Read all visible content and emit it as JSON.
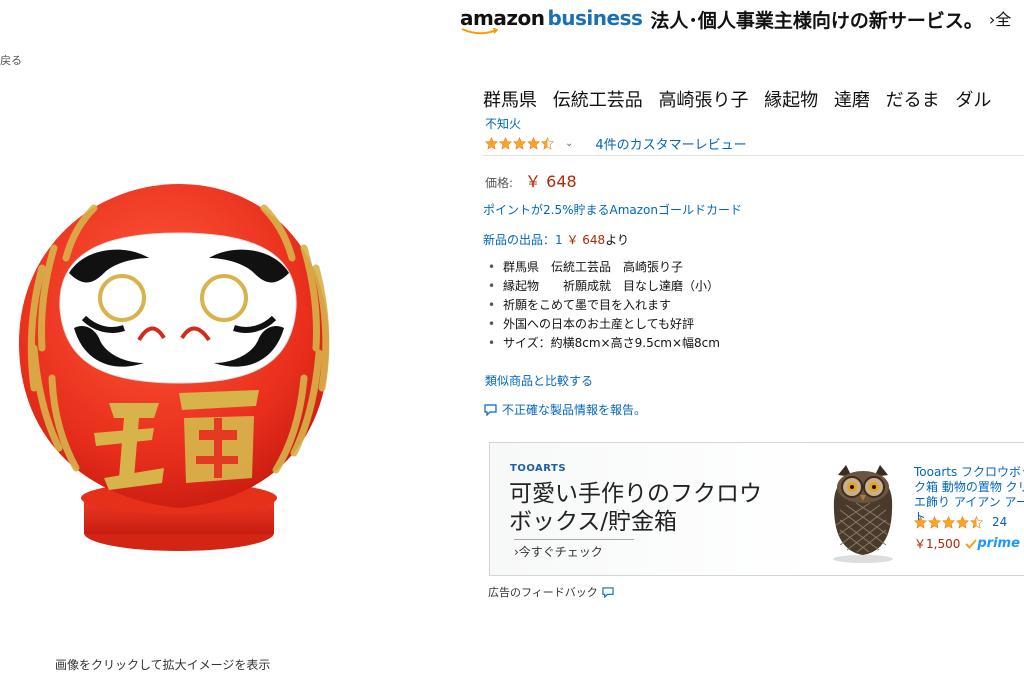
{
  "nav": {
    "back_label": "戻る"
  },
  "banner": {
    "logo_part1": "amazon",
    "logo_part2": "business",
    "tagline": "法人･個人事業主様向けの新サービス。",
    "more": "›全"
  },
  "product": {
    "title": "群馬県 伝統工芸品 高崎張り子 縁起物 達磨 だるま ダル",
    "brand": "不知火",
    "rating_stars": 4.5,
    "review_link": "4件のカスタマーレビュー",
    "price_label": "価格:",
    "price": "￥ 648",
    "points_link": "ポイントが2.5%貯まるAmazonゴールドカード",
    "new_offer_prefix": "新品の出品：1",
    "new_offer_price": "￥ 648",
    "new_offer_suffix": "より",
    "bullets": [
      "群馬県　伝統工芸品　高崎張り子",
      "縁起物　　祈願成就　目なし達磨（小）",
      "祈願をこめて墨で目を入れます",
      "外国への日本のお土産としても好評",
      "サイズ：約横8cm×高さ9.5cm×幅8cm"
    ],
    "compare_link": "類似商品と比較する",
    "report_link": "不正確な製品情報を報告。",
    "image_hint": "画像をクリックして拡大イメージを表示"
  },
  "ad": {
    "brand": "TOOARTS",
    "headline": "可愛い手作りのフクロウボックス/貯金箱",
    "cta": "›今すぐチェック",
    "product_title": "Tooarts フクロウボック箱 動物の置物 クリエ飾り アイアン アート",
    "rating_stars": 4.5,
    "review_count": "24",
    "price": "￥1,500",
    "prime": "prime",
    "feedback": "広告のフィードバック"
  },
  "colors": {
    "link": "#0066c0",
    "price": "#b12704",
    "star": "#ffa41c",
    "business_blue": "#1a6fb5",
    "prime_blue": "#1a98ff"
  }
}
